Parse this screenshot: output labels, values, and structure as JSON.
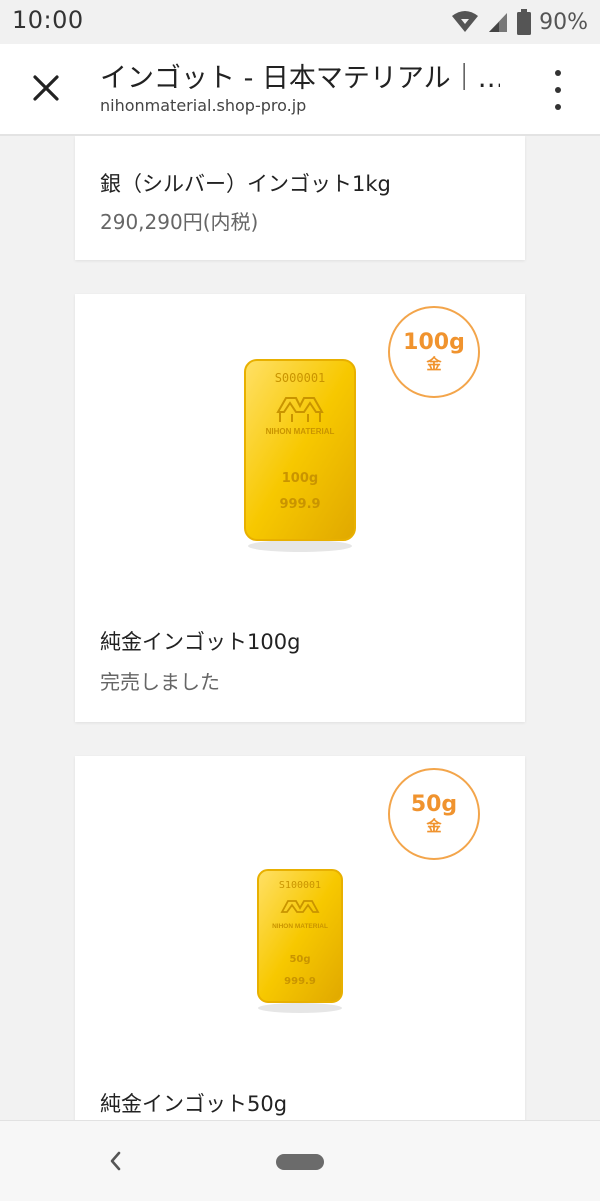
{
  "status": {
    "time": "10:00",
    "battery": "90%",
    "icons": [
      "wifi-icon",
      "signal-icon",
      "battery-icon"
    ]
  },
  "header": {
    "title": "インゴット - 日本マテリアル｜…",
    "url": "nihonmaterial.shop-pro.jp",
    "close_icon": "close-icon",
    "menu_icon": "more-vert-icon"
  },
  "products": [
    {
      "name": "銀（シルバー）インゴット1kg",
      "price": "290,290円(内税)"
    },
    {
      "name": "純金インゴット100g",
      "status": "完売しました",
      "badge_weight": "100g",
      "badge_metal": "金",
      "bar_serial": "S000001",
      "bar_brand": "NIHON MATERIAL",
      "bar_weight": "100g",
      "bar_purity": "999.9"
    },
    {
      "name": "純金インゴット50g",
      "badge_weight": "50g",
      "badge_metal": "金",
      "bar_serial": "S100001",
      "bar_brand": "NIHON MATERIAL",
      "bar_weight": "50g",
      "bar_purity": "999.9"
    }
  ],
  "colors": {
    "badge_orange": "#f0932e",
    "gold": "#f6c300"
  },
  "navbar": {
    "back_icon": "back-icon",
    "home_icon": "home-pill-icon"
  }
}
